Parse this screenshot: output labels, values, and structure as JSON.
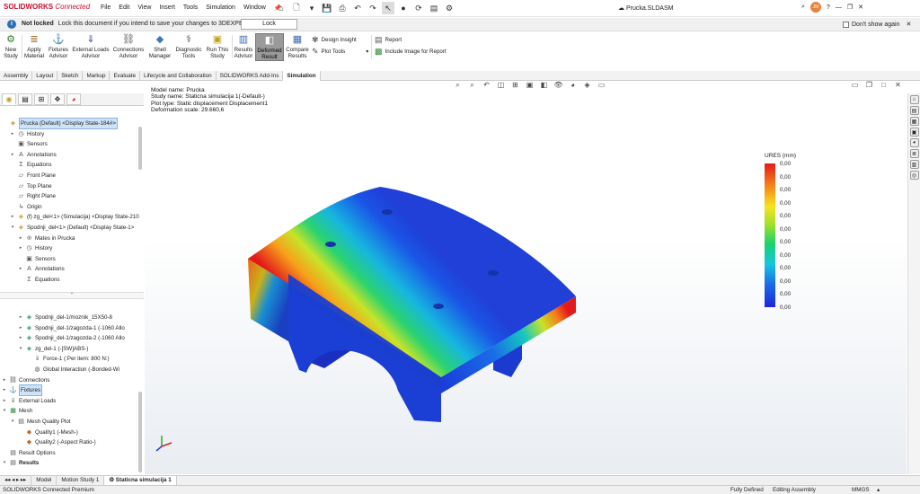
{
  "app": {
    "logo_brand": "SOLIDWORKS",
    "logo_suffix": "Connected",
    "document": "Prucka.SLDASM",
    "user_initials": "JM"
  },
  "menu": [
    "File",
    "Edit",
    "View",
    "Insert",
    "Tools",
    "Simulation",
    "Window"
  ],
  "infobar": {
    "bold": "Not locked",
    "message": "Lock this document if you intend to save your changes to 3DEXPERIENCE.",
    "lock_button": "Lock",
    "dont_show": "Don't show again"
  },
  "ribbon": {
    "new_study": [
      "New",
      "Study"
    ],
    "apply_material": [
      "Apply",
      "Material"
    ],
    "fixtures_advisor": [
      "Fixtures",
      "Advisor"
    ],
    "external_loads_advisor": [
      "External Loads",
      "Advisor"
    ],
    "connections_advisor": [
      "Connections",
      "Advisor"
    ],
    "shell_manager": [
      "Shell",
      "Manager"
    ],
    "diagnostic_tools": [
      "Diagnostic",
      "Tools"
    ],
    "run_this_study": [
      "Run This",
      "Study"
    ],
    "results_advisor": [
      "Results",
      "Advisor"
    ],
    "deformed_result": [
      "Deformed",
      "Result"
    ],
    "compare_results": [
      "Compare",
      "Results"
    ],
    "design_insight": "Design Insight",
    "plot_tools": "Plot Tools",
    "report": "Report",
    "include_image": "Include Image for Report"
  },
  "tabs": [
    "Assembly",
    "Layout",
    "Sketch",
    "Markup",
    "Evaluate",
    "Lifecycle and Collaboration",
    "SOLIDWORKS Add-Ins",
    "Simulation"
  ],
  "active_tab": "Simulation",
  "tree_top": [
    {
      "label": "Prucka (Default) <Display State-184#>",
      "icon": "assembly-icon",
      "indent": 0,
      "twisty": "",
      "selected": true
    },
    {
      "label": "History",
      "icon": "history-icon",
      "indent": 1,
      "twisty": "▸"
    },
    {
      "label": "Sensors",
      "icon": "sensor-icon",
      "indent": 1,
      "twisty": ""
    },
    {
      "label": "Annotations",
      "icon": "annotation-icon",
      "indent": 1,
      "twisty": "▸"
    },
    {
      "label": "Equations",
      "icon": "equation-icon",
      "indent": 1,
      "twisty": ""
    },
    {
      "label": "Front Plane",
      "icon": "plane-icon",
      "indent": 1,
      "twisty": ""
    },
    {
      "label": "Top Plane",
      "icon": "plane-icon",
      "indent": 1,
      "twisty": ""
    },
    {
      "label": "Right Plane",
      "icon": "plane-icon",
      "indent": 1,
      "twisty": ""
    },
    {
      "label": "Origin",
      "icon": "origin-icon",
      "indent": 1,
      "twisty": ""
    },
    {
      "label": "(f) zg_del<1> (Simulacija) <Display State-210",
      "icon": "part-icon",
      "indent": 1,
      "twisty": "▸"
    },
    {
      "label": "Spodnji_del<1> (Default) <Display State-1>",
      "icon": "part-icon",
      "indent": 1,
      "twisty": "▾"
    },
    {
      "label": "Mates in Prucka",
      "icon": "mates-icon",
      "indent": 2,
      "twisty": "▸"
    },
    {
      "label": "History",
      "icon": "history-icon",
      "indent": 2,
      "twisty": "▸"
    },
    {
      "label": "Sensors",
      "icon": "sensor-icon",
      "indent": 2,
      "twisty": ""
    },
    {
      "label": "Annotations",
      "icon": "annotation-icon",
      "indent": 2,
      "twisty": "▸"
    },
    {
      "label": "Equations",
      "icon": "equation-icon",
      "indent": 2,
      "twisty": ""
    }
  ],
  "tree_bottom": [
    {
      "label": "Spodnji_del-1/moznik_15X50-8",
      "icon": "component-icon",
      "indent": 2,
      "twisty": "▸"
    },
    {
      "label": "Spodnji_del-1/zagozda-1 (-1060 Allo",
      "icon": "component-icon",
      "indent": 2,
      "twisty": "▸"
    },
    {
      "label": "Spodnji_del-1/zagozda-2 (-1060 Allo",
      "icon": "component-icon",
      "indent": 2,
      "twisty": "▸"
    },
    {
      "label": "zg_del-1 (-[SW]ABS-)",
      "icon": "component-icon",
      "indent": 2,
      "twisty": "▾"
    },
    {
      "label": "Force-1 (:Per item: 800 N:)",
      "icon": "force-icon",
      "indent": 3,
      "twisty": ""
    },
    {
      "label": "Global Interaction (-Bonded-Wi",
      "icon": "interaction-icon",
      "indent": 3,
      "twisty": ""
    },
    {
      "label": "Connections",
      "icon": "connections-icon",
      "indent": 0,
      "twisty": "▸"
    },
    {
      "label": "Fixtures",
      "icon": "fixtures-icon",
      "indent": 0,
      "twisty": "▸",
      "selected": true
    },
    {
      "label": "External Loads",
      "icon": "loads-icon",
      "indent": 0,
      "twisty": "▸"
    },
    {
      "label": "Mesh",
      "icon": "mesh-icon",
      "indent": 0,
      "twisty": "▾"
    },
    {
      "label": "Mesh Quality Plot",
      "icon": "plot-folder-icon",
      "indent": 1,
      "twisty": "▾"
    },
    {
      "label": "Quality1 (-Mesh-)",
      "icon": "quality-plot-icon",
      "indent": 2,
      "twisty": ""
    },
    {
      "label": "Quality2 (-Aspect Ratio-)",
      "icon": "quality-plot-icon",
      "indent": 2,
      "twisty": ""
    },
    {
      "label": "Result Options",
      "icon": "options-icon",
      "indent": 0,
      "twisty": ""
    },
    {
      "label": "Results",
      "icon": "results-icon",
      "indent": 0,
      "twisty": "▾",
      "bold": true
    }
  ],
  "viewport_info": {
    "model_name": "Model name: Prucka",
    "study_name": "Study name: Staticna simulacija 1(-Default-)",
    "plot_type": "Plot type: Static displacement Displacement1",
    "deformation_scale": "Deformation scale: 29.660,6"
  },
  "legend": {
    "title": "URES (mm)",
    "ticks": [
      "0,00",
      "0,00",
      "0,00",
      "0,00",
      "0,00",
      "0,00",
      "0,00",
      "0,00",
      "0,00",
      "0,00",
      "0,00",
      "0,00"
    ],
    "colors": [
      "#e31a1c",
      "#f47a18",
      "#f7e51e",
      "#93df2d",
      "#18d36f",
      "#16c6e0",
      "#1a6ce8",
      "#1c25d8"
    ]
  },
  "bottom_tabs": [
    "Model",
    "Motion Study 1",
    "Staticna simulacija 1"
  ],
  "active_bottom_tab": "Staticna simulacija 1",
  "status": {
    "product": "SOLIDWORKS Connected Premium",
    "fully_defined": "Fully Defined",
    "mode": "Editing Assembly",
    "units": "MMGS"
  }
}
